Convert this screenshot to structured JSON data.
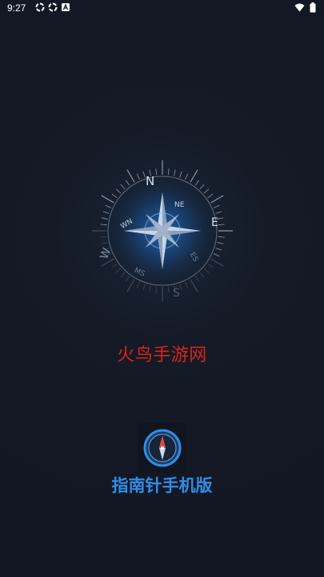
{
  "status_bar": {
    "time": "9:27",
    "left_icons": [
      "sync-icon",
      "sync-icon",
      "notification-a-icon"
    ],
    "right_icons": [
      "wifi-icon",
      "battery-icon"
    ]
  },
  "compass": {
    "directions": {
      "n": "N",
      "e": "E",
      "s": "S",
      "w": "W",
      "ne": "NE",
      "nw": "WN",
      "se": "ES",
      "sw": "MS"
    },
    "accent_color": "#1f74d6"
  },
  "site_name": "火鸟手游网",
  "site_name_color": "#d9241f",
  "app": {
    "icon": "compass-app-icon",
    "title": "指南针手机版",
    "title_color": "#2f8de8"
  }
}
